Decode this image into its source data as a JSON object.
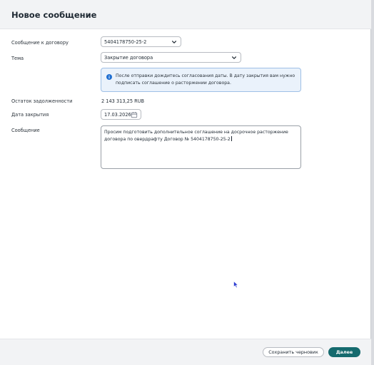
{
  "dialog": {
    "title": "Новое сообщение"
  },
  "form": {
    "contract_label": "Сообщение к договору",
    "contract_value": "5404178750-25-2",
    "topic_label": "Тема",
    "topic_value": "Закрытие договора",
    "info_text": "После отправки дождитесь согласования даты. В дату закрытия вам нужно подписать соглашение о расторжении договора.",
    "debt_label": "Остаток задолженности",
    "debt_value": "2 143 313,25 RUB",
    "close_date_label": "Дата закрытия",
    "close_date_value": "17.03.2026",
    "message_label": "Сообщение",
    "message_value": "Просим подготовить дополнительное соглашение на досрочное расторжение договора по овердрафту Договор № 5404178750-25-2"
  },
  "footer": {
    "save_draft_label": "Сохранить черновик",
    "next_label": "Далее"
  },
  "colors": {
    "primary": "#156a6e",
    "info_bg": "#eaf2fb",
    "info_border": "#9fc0e6",
    "info_icon": "#1f6fd1"
  },
  "icons": [
    "chevron-down-icon",
    "info-icon",
    "calendar-icon",
    "mouse-cursor-icon"
  ]
}
